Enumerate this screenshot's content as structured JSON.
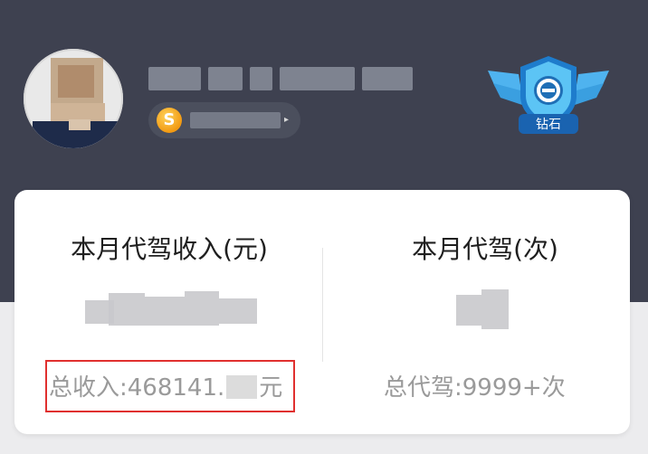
{
  "profile": {
    "avatar_icon": "user-avatar",
    "coin_icon": "gold-coin-icon",
    "coin_symbol": "S",
    "arrow": "▸",
    "rank_badge_icon": "diamond-rank-badge",
    "rank_badge_label": "钻石"
  },
  "stats": {
    "left_title": "本月代驾收入(元)",
    "right_title": "本月代驾(次)",
    "total_income_label": "总收入:468141.",
    "total_income_unit": "元",
    "total_rides_label": "总代驾:9999+次"
  },
  "colors": {
    "header_bg": "#3e4150",
    "card_bg": "#ffffff",
    "highlight_border": "#e0302f",
    "badge_blue": "#2f8fe0"
  }
}
